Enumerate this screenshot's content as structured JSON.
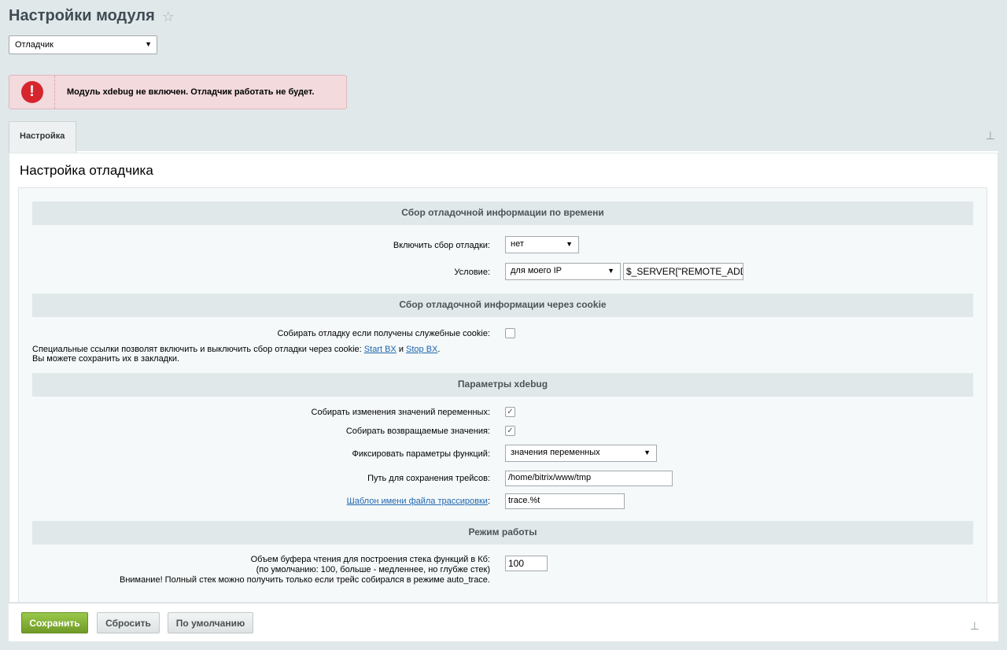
{
  "page": {
    "title": "Настройки модуля",
    "star_icon": "star-icon"
  },
  "module_select": {
    "value": "Отладчик"
  },
  "alert": {
    "icon": "error-icon",
    "text": "Модуль xdebug не включен. Отладчик работать не будет."
  },
  "tabs": [
    {
      "label": "Настройка"
    }
  ],
  "panel": {
    "title": "Настройка отладчика"
  },
  "sections": {
    "time": {
      "title": "Сбор отладочной информации по времени",
      "enable_label": "Включить сбор отладки:",
      "enable_value": "нет",
      "condition_label": "Условие:",
      "condition_value": "для моего IP",
      "condition_expr": "$_SERVER[\"REMOTE_ADD"
    },
    "cookie": {
      "title": "Сбор отладочной информации через cookie",
      "collect_label": "Собирать отладку если получены служебные cookie:",
      "note_prefix": "Специальные ссылки позволят включить и выключить сбор отладки через cookie: ",
      "link_start": "Start BX",
      "note_and": " и ",
      "link_stop": "Stop BX",
      "note_dot": ".",
      "note_line2": "Вы можете сохранить их в закладки."
    },
    "xdebug": {
      "title": "Параметры xdebug",
      "vars_label": "Собирать изменения значений переменных:",
      "returns_label": "Собирать возвращаемые значения:",
      "params_label": "Фиксировать параметры функций:",
      "params_value": "значения переменных",
      "path_label": "Путь для сохранения трейсов:",
      "path_value": "/home/bitrix/www/tmp",
      "template_label": "Шаблон имени файла трассировки",
      "template_colon": ":",
      "template_value": "trace.%t"
    },
    "mode": {
      "title": "Режим работы",
      "buffer_label_1": "Объем буфера чтения для построения стека функций в Кб:",
      "buffer_label_2": "(по умолчанию: 100, больше - медленнее, но глубже стек)",
      "buffer_label_3": "Внимание! Полный стек можно получить только если трейс собирался в режиме auto_trace.",
      "buffer_value": "100"
    }
  },
  "footer": {
    "save": "Сохранить",
    "reset": "Сбросить",
    "default": "По умолчанию"
  },
  "colors": {
    "save_green": "#8bb53c",
    "alert_bg": "#f2dadd",
    "alert_red": "#d5262d",
    "link": "#2067b0"
  }
}
